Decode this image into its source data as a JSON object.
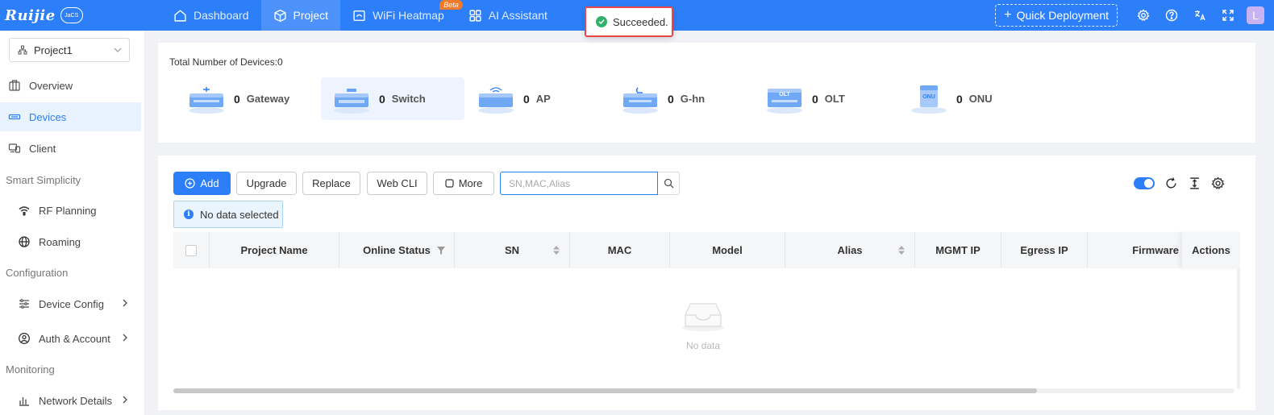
{
  "brand": {
    "logo": "Ruijie",
    "cloud_label": "JaCS"
  },
  "nav": {
    "items": [
      {
        "label": "Dashboard",
        "icon": "home-icon",
        "active": false
      },
      {
        "label": "Project",
        "icon": "cube-icon",
        "active": true
      },
      {
        "label": "WiFi Heatmap",
        "icon": "map-icon",
        "active": false,
        "badge": "Beta"
      },
      {
        "label": "AI Assistant",
        "icon": "grid-icon",
        "active": false
      }
    ]
  },
  "toast": {
    "message": "Succeeded."
  },
  "top_right": {
    "quick_deploy_label": "Quick Deployment",
    "icons": [
      "settings-icon",
      "help-icon",
      "language-icon",
      "fullscreen-icon"
    ],
    "avatar_initial": "L"
  },
  "sidebar": {
    "project_select": "Project1",
    "items": [
      {
        "label": "Overview",
        "icon": "overview-icon"
      },
      {
        "label": "Devices",
        "icon": "devices-icon",
        "active": true
      },
      {
        "label": "Client",
        "icon": "client-icon"
      }
    ],
    "groups": [
      {
        "title": "Smart Simplicity",
        "items": [
          {
            "label": "RF Planning",
            "icon": "wifi-icon"
          },
          {
            "label": "Roaming",
            "icon": "globe-icon"
          }
        ]
      },
      {
        "title": "Configuration",
        "items": [
          {
            "label": "Device Config",
            "icon": "sliders-icon"
          },
          {
            "label": "Auth & Account",
            "icon": "user-icon"
          }
        ]
      },
      {
        "title": "Monitoring",
        "items": [
          {
            "label": "Network Details",
            "icon": "chart-icon"
          }
        ]
      }
    ]
  },
  "summary": {
    "total_label": "Total Number of Devices:0",
    "types": [
      {
        "count": "0",
        "name": "Gateway"
      },
      {
        "count": "0",
        "name": "Switch",
        "active": true
      },
      {
        "count": "0",
        "name": "AP"
      },
      {
        "count": "0",
        "name": "G-hn"
      },
      {
        "count": "0",
        "name": "OLT",
        "icon_text": "OLT"
      },
      {
        "count": "0",
        "name": "ONU",
        "icon_text": "ONU"
      }
    ]
  },
  "toolbar": {
    "add": "Add",
    "upgrade": "Upgrade",
    "replace": "Replace",
    "webcli": "Web CLI",
    "more": "More",
    "search_placeholder": "SN,MAC,Alias",
    "selection_info": "No data selected"
  },
  "table": {
    "columns": [
      "Project Name",
      "Online Status",
      "SN",
      "MAC",
      "Model",
      "Alias",
      "MGMT IP",
      "Egress IP",
      "Firmware"
    ],
    "actions_label": "Actions",
    "empty_text": "No data"
  },
  "colors": {
    "primary": "#2d7ff9",
    "success": "#32b16c",
    "toast_border": "#e8474a"
  }
}
